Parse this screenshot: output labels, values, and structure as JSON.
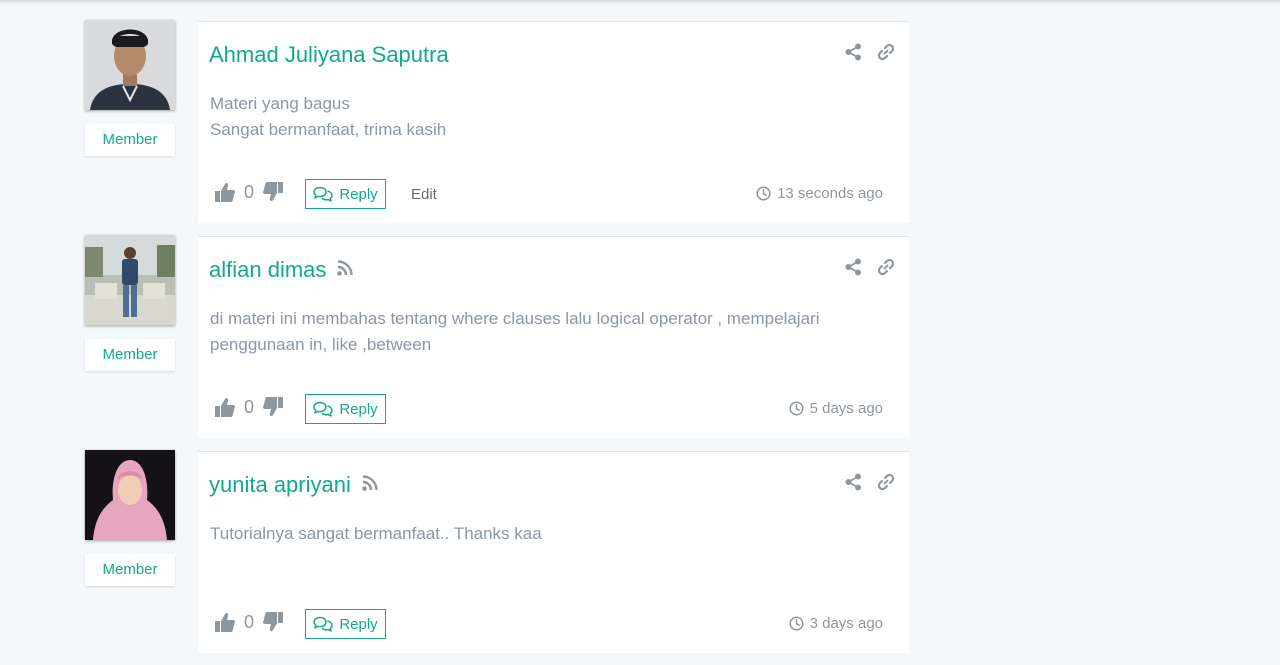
{
  "labels": {
    "reply": "Reply",
    "edit": "Edit"
  },
  "colors": {
    "accent": "#13a98c",
    "text_muted": "#8a97a5",
    "icon_gray": "#8f979e"
  },
  "comments": [
    {
      "author": "Ahmad Juliyana Saputra",
      "role": "Member",
      "lines": [
        "Materi yang bagus",
        "Sangat bermanfaat, trima kasih"
      ],
      "votes": "0",
      "time": "13 seconds ago",
      "has_feed_icon": false,
      "has_edit": true
    },
    {
      "author": "alfian dimas",
      "role": "Member",
      "lines": [
        "di materi ini membahas tentang where clauses lalu logical operator , mempelajari",
        "penggunaan in, like ,between"
      ],
      "votes": "0",
      "time": "5 days ago",
      "has_feed_icon": true,
      "has_edit": false
    },
    {
      "author": "yunita apriyani",
      "role": "Member",
      "lines": [
        "Tutorialnya sangat bermanfaat.. Thanks kaa"
      ],
      "votes": "0",
      "time": "3 days ago",
      "has_feed_icon": true,
      "has_edit": false
    }
  ]
}
